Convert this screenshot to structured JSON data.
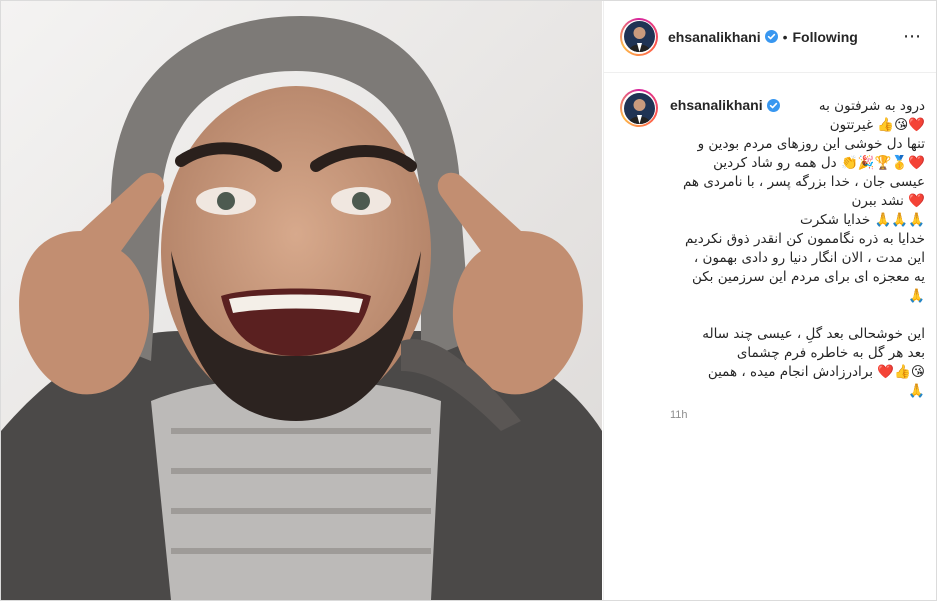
{
  "post": {
    "username": "ehsanalikhani",
    "follow_status": "Following",
    "separator": "•",
    "more_icon": "⋯",
    "verified_color": "#3897f0"
  },
  "caption": {
    "username": "ehsanalikhani",
    "lines": [
      "درود به شرفتون به",
      "❤️😘👍 غیرتتون",
      "تنها دل خوشی این روزهای مردم بودین و",
      "❤️🥇🏆🎉👏 دل همه رو شاد کردین",
      "عیسی جان ، خدا بزرگه پسر ، با نامردی هم",
      "❤️ نشد ببرن",
      "🙏🙏🙏 خدایا شکرت",
      "خدایا به ذره نگاممون کن انقدر ذوق نکردیم",
      "این مدت ، الان انگار دنیا رو دادی بهمون ،",
      "یه معجزه ای برای مردم این سرزمین بکن",
      "🙏",
      "",
      "این خوشحالی بعد گلِ ، عیسی چند ساله",
      "بعد هر گل به خاطره فرم چشمای",
      "😘👍❤️ برادرزادش انجام میده ، همین",
      "🙏"
    ],
    "timestamp": "11h"
  }
}
